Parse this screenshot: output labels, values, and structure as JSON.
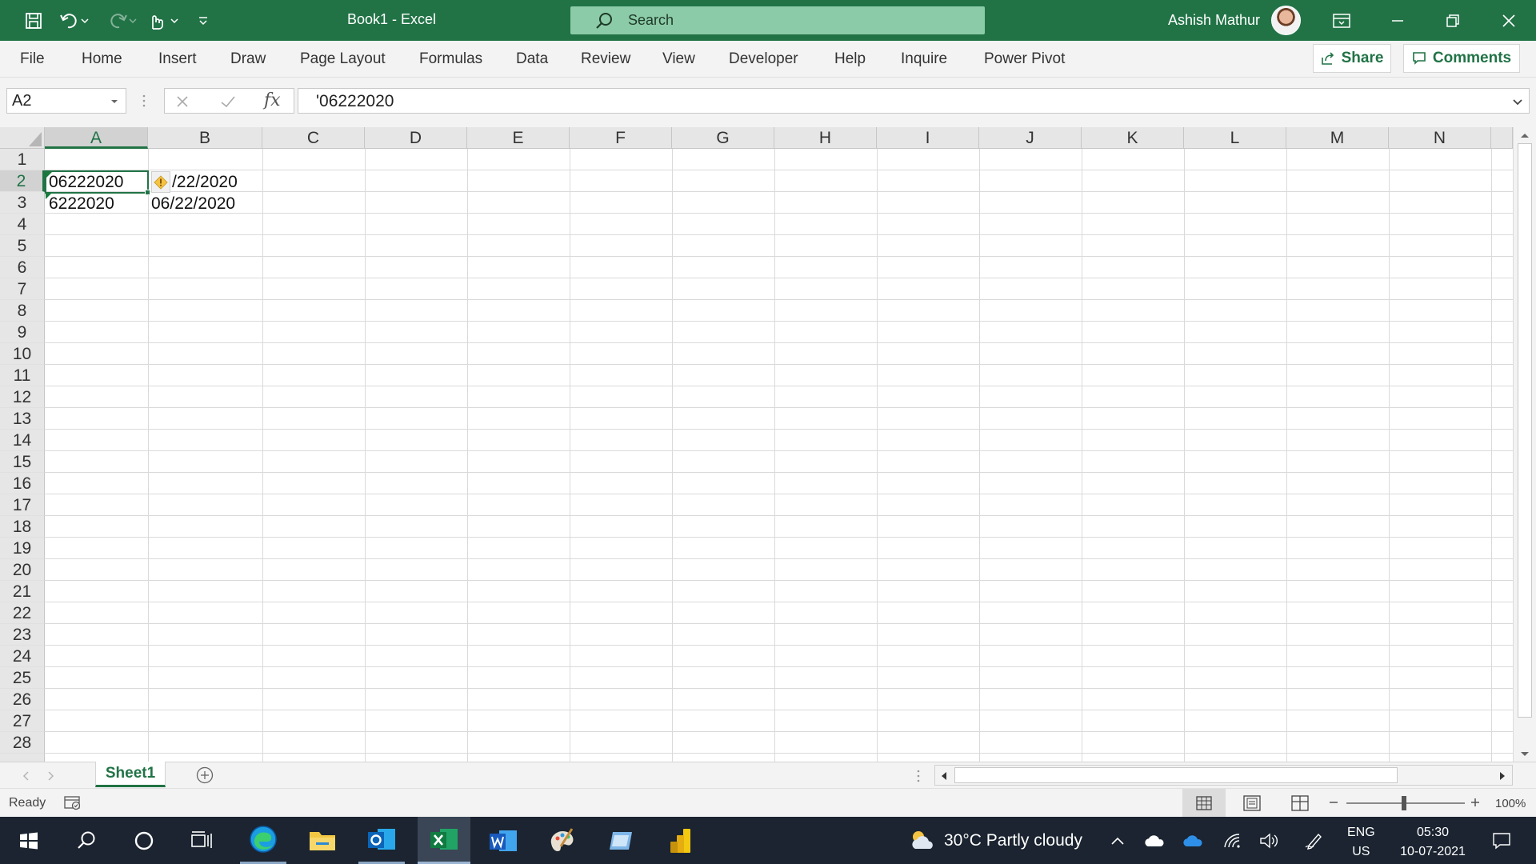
{
  "window": {
    "doc_title": "Book1  -  Excel",
    "search_placeholder": "Search",
    "user_name": "Ashish Mathur",
    "accent": "#217346"
  },
  "ribbon": {
    "tabs": [
      "File",
      "Home",
      "Insert",
      "Draw",
      "Page Layout",
      "Formulas",
      "Data",
      "Review",
      "View",
      "Developer",
      "Help",
      "Inquire",
      "Power Pivot"
    ],
    "share_label": "Share",
    "comments_label": "Comments"
  },
  "formula_bar": {
    "name_box": "A2",
    "formula": "'06222020",
    "fx_label": "fx"
  },
  "grid": {
    "columns": [
      "A",
      "B",
      "C",
      "D",
      "E",
      "F",
      "G",
      "H",
      "I",
      "J",
      "K",
      "L",
      "M",
      "N"
    ],
    "rows": [
      "1",
      "2",
      "3",
      "4",
      "5",
      "6",
      "7",
      "8",
      "9",
      "10",
      "11",
      "12",
      "13",
      "14",
      "15",
      "16",
      "17",
      "18",
      "19",
      "20",
      "21",
      "22",
      "23",
      "24",
      "25",
      "26",
      "27",
      "28"
    ],
    "selected_cell": "A2",
    "cells": {
      "A2": "06222020",
      "B2": "/22/2020",
      "A3": "6222020",
      "B3": "06/22/2020"
    }
  },
  "sheets": {
    "tabs": [
      "Sheet1"
    ],
    "active": "Sheet1"
  },
  "status_bar": {
    "status": "Ready",
    "zoom": "100%"
  },
  "taskbar": {
    "weather": "30°C  Partly cloudy",
    "lang_1": "ENG",
    "lang_2": "US",
    "time": "05:30",
    "date": "10-07-2021"
  }
}
